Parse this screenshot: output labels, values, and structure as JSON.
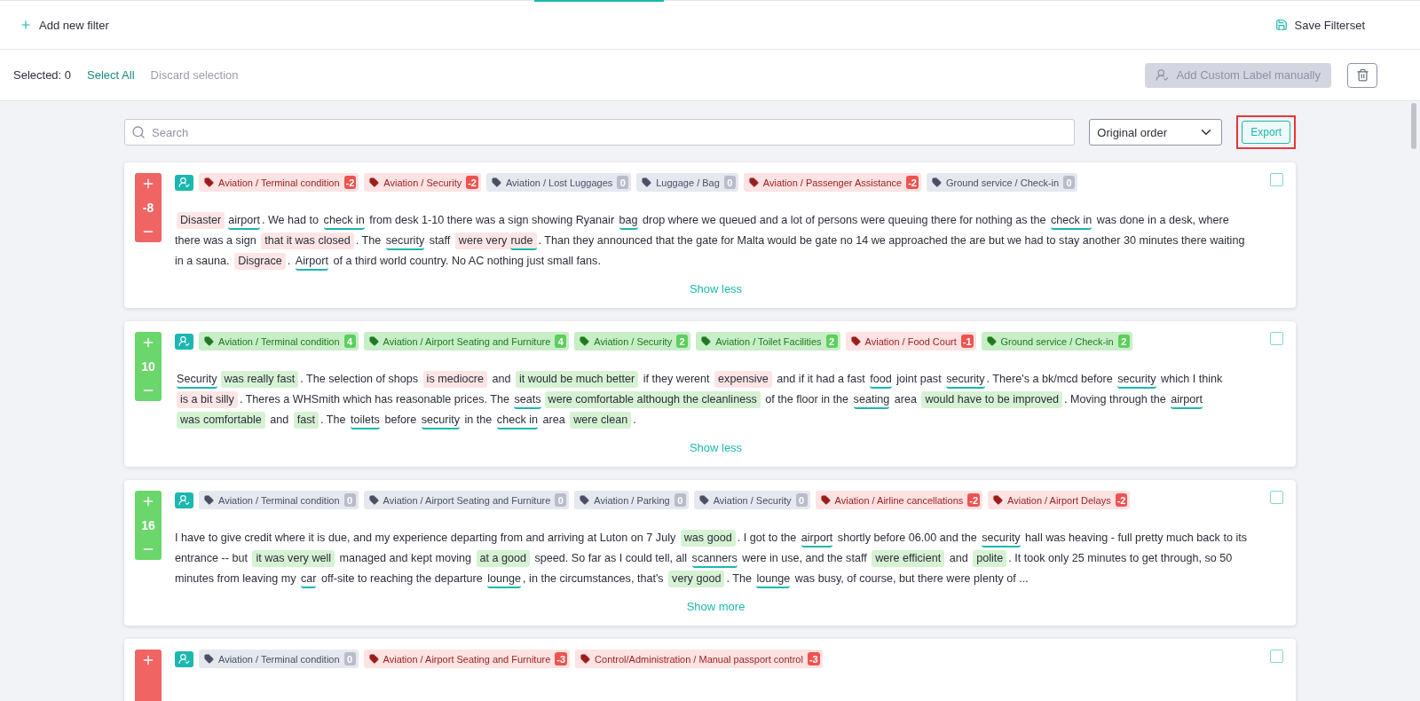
{
  "header": {
    "add_filter": "Add new filter",
    "save_filterset": "Save Filterset"
  },
  "selection_bar": {
    "selected_label": "Selected:",
    "selected_count": "0",
    "select_all": "Select All",
    "discard": "Discard selection",
    "add_label_button": {
      "label": "Add Custom Label manually",
      "disabled": true
    }
  },
  "toolbar": {
    "search": {
      "placeholder": "Search"
    },
    "sort": {
      "value": "Original order"
    },
    "export": {
      "label": "Export",
      "outlined": true
    }
  },
  "reviews": [
    {
      "score": "-8",
      "kind": "negative",
      "checked": false,
      "tags": [
        {
          "label": "Aviation / Terminal condition",
          "count": "-2",
          "kind": "negative"
        },
        {
          "label": "Aviation / Security",
          "count": "-2",
          "kind": "negative"
        },
        {
          "label": "Aviation / Lost Luggages",
          "count": "0",
          "kind": "neutral"
        },
        {
          "label": "Luggage / Bag",
          "count": "0",
          "kind": "neutral"
        },
        {
          "label": "Aviation / Passenger Assistance",
          "count": "-2",
          "kind": "negative"
        },
        {
          "label": "Ground service / Check-in",
          "count": "0",
          "kind": "neutral"
        }
      ],
      "segments": [
        {
          "text": "Disaster",
          "kind": "negative"
        },
        {
          "text": "airport",
          "kind": "aspect"
        },
        {
          "text": ". We had to ",
          "kind": "plain"
        },
        {
          "text": "check in",
          "kind": "aspect"
        },
        {
          "text": " from desk 1-10 there was a sign showing Ryanair ",
          "kind": "plain"
        },
        {
          "text": "bag",
          "kind": "aspect"
        },
        {
          "text": " drop where we queued and a lot of persons were queuing there for nothing as the ",
          "kind": "plain"
        },
        {
          "text": "check in",
          "kind": "aspect"
        },
        {
          "text": " was done in a desk, where there was a sign ",
          "kind": "plain"
        },
        {
          "text": "that it was closed",
          "kind": "negative"
        },
        {
          "text": ". The ",
          "kind": "plain"
        },
        {
          "text": "security",
          "kind": "aspect"
        },
        {
          "text": " staff ",
          "kind": "plain"
        },
        {
          "text": "were very",
          "kind": "negative"
        },
        {
          "text": "rude",
          "kind": "negative-aspect"
        },
        {
          "text": ". Than they announced that the gate for Malta would be gate no 14 we approached the are but we had to stay another 30 minutes there waiting in a sauna. ",
          "kind": "plain"
        },
        {
          "text": "Disgrace",
          "kind": "negative"
        },
        {
          "text": ". ",
          "kind": "plain"
        },
        {
          "text": "Airport",
          "kind": "aspect"
        },
        {
          "text": " of a third world country. No AC nothing just small fans.",
          "kind": "plain"
        }
      ],
      "toggle": "Show less"
    },
    {
      "score": "10",
      "kind": "positive",
      "checked": false,
      "tags": [
        {
          "label": "Aviation / Terminal condition",
          "count": "4",
          "kind": "positive"
        },
        {
          "label": "Aviation / Airport Seating and Furniture",
          "count": "4",
          "kind": "positive"
        },
        {
          "label": "Aviation / Security",
          "count": "2",
          "kind": "positive"
        },
        {
          "label": "Aviation / Toilet Facilities",
          "count": "2",
          "kind": "positive"
        },
        {
          "label": "Aviation / Food Court",
          "count": "-1",
          "kind": "negative"
        },
        {
          "label": "Ground service / Check-in",
          "count": "2",
          "kind": "positive"
        }
      ],
      "segments": [
        {
          "text": "Security",
          "kind": "aspect"
        },
        {
          "text": "was really fast",
          "kind": "positive"
        },
        {
          "text": ". The selection of shops ",
          "kind": "plain"
        },
        {
          "text": "is mediocre",
          "kind": "negative"
        },
        {
          "text": " and ",
          "kind": "plain"
        },
        {
          "text": "it would be much better",
          "kind": "positive"
        },
        {
          "text": " if they werent ",
          "kind": "plain"
        },
        {
          "text": "expensive",
          "kind": "negative"
        },
        {
          "text": " and if it had a fast ",
          "kind": "plain"
        },
        {
          "text": "food",
          "kind": "aspect"
        },
        {
          "text": " joint past ",
          "kind": "plain"
        },
        {
          "text": "security",
          "kind": "aspect"
        },
        {
          "text": ". There's a bk/mcd before ",
          "kind": "plain"
        },
        {
          "text": "security",
          "kind": "aspect"
        },
        {
          "text": " which I think ",
          "kind": "plain"
        },
        {
          "text": "is a bit silly",
          "kind": "negative"
        },
        {
          "text": ". Theres a WHSmith which has reasonable prices. The ",
          "kind": "plain"
        },
        {
          "text": "seats",
          "kind": "aspect"
        },
        {
          "text": "were comfortable although the cleanliness",
          "kind": "positive"
        },
        {
          "text": " of the floor in the ",
          "kind": "plain"
        },
        {
          "text": "seating",
          "kind": "aspect"
        },
        {
          "text": " area ",
          "kind": "plain"
        },
        {
          "text": "would have to be improved",
          "kind": "positive"
        },
        {
          "text": ". Moving through the ",
          "kind": "plain"
        },
        {
          "text": "airport",
          "kind": "aspect"
        },
        {
          "text": "was comfortable",
          "kind": "positive"
        },
        {
          "text": " and ",
          "kind": "plain"
        },
        {
          "text": "fast",
          "kind": "positive"
        },
        {
          "text": ". The ",
          "kind": "plain"
        },
        {
          "text": "toilets",
          "kind": "aspect"
        },
        {
          "text": " before ",
          "kind": "plain"
        },
        {
          "text": "security",
          "kind": "aspect"
        },
        {
          "text": " in the ",
          "kind": "plain"
        },
        {
          "text": "check in",
          "kind": "aspect"
        },
        {
          "text": " area ",
          "kind": "plain"
        },
        {
          "text": "were clean",
          "kind": "positive"
        },
        {
          "text": ".",
          "kind": "plain"
        }
      ],
      "toggle": "Show less"
    },
    {
      "score": "16",
      "kind": "positive",
      "checked": false,
      "tags": [
        {
          "label": "Aviation / Terminal condition",
          "count": "0",
          "kind": "neutral"
        },
        {
          "label": "Aviation / Airport Seating and Furniture",
          "count": "0",
          "kind": "neutral"
        },
        {
          "label": "Aviation / Parking",
          "count": "0",
          "kind": "neutral"
        },
        {
          "label": "Aviation / Security",
          "count": "0",
          "kind": "neutral"
        },
        {
          "label": "Aviation / Airline cancellations",
          "count": "-2",
          "kind": "negative"
        },
        {
          "label": "Aviation / Airport Delays",
          "count": "-2",
          "kind": "negative"
        }
      ],
      "segments": [
        {
          "text": "I have to give credit where it is due, and my experience departing from and arriving at Luton on 7 July ",
          "kind": "plain"
        },
        {
          "text": "was good",
          "kind": "positive"
        },
        {
          "text": ". I got to the ",
          "kind": "plain"
        },
        {
          "text": "airport",
          "kind": "aspect"
        },
        {
          "text": " shortly before 06.00 and the ",
          "kind": "plain"
        },
        {
          "text": "security",
          "kind": "aspect"
        },
        {
          "text": " hall was heaving - full pretty much back to its entrance -- but ",
          "kind": "plain"
        },
        {
          "text": "it was very well",
          "kind": "positive"
        },
        {
          "text": " managed and kept moving ",
          "kind": "plain"
        },
        {
          "text": "at a good",
          "kind": "positive"
        },
        {
          "text": " speed. So far as I could tell, all ",
          "kind": "plain"
        },
        {
          "text": "scanners",
          "kind": "aspect"
        },
        {
          "text": " were in use, and the staff ",
          "kind": "plain"
        },
        {
          "text": "were efficient",
          "kind": "positive"
        },
        {
          "text": " and ",
          "kind": "plain"
        },
        {
          "text": "polite",
          "kind": "positive"
        },
        {
          "text": ". It took only 25 minutes to get through, so 50 minutes from leaving my ",
          "kind": "plain"
        },
        {
          "text": "car",
          "kind": "aspect"
        },
        {
          "text": " off-site to reaching the departure ",
          "kind": "plain"
        },
        {
          "text": "lounge",
          "kind": "aspect"
        },
        {
          "text": ", in the circumstances, that's ",
          "kind": "plain"
        },
        {
          "text": "very good",
          "kind": "positive"
        },
        {
          "text": ". The ",
          "kind": "plain"
        },
        {
          "text": "lounge",
          "kind": "aspect"
        },
        {
          "text": " was busy, of course, but there were plenty of ...",
          "kind": "plain"
        }
      ],
      "toggle": "Show more"
    },
    {
      "kind": "negative",
      "checked": false,
      "tags": [
        {
          "label": "Aviation / Terminal condition",
          "count": "0",
          "kind": "neutral"
        },
        {
          "label": "Aviation / Airport Seating and Furniture",
          "count": "-3",
          "kind": "negative"
        },
        {
          "label": "Control/Administration / Manual passport control",
          "count": "-3",
          "kind": "negative"
        }
      ]
    }
  ]
}
